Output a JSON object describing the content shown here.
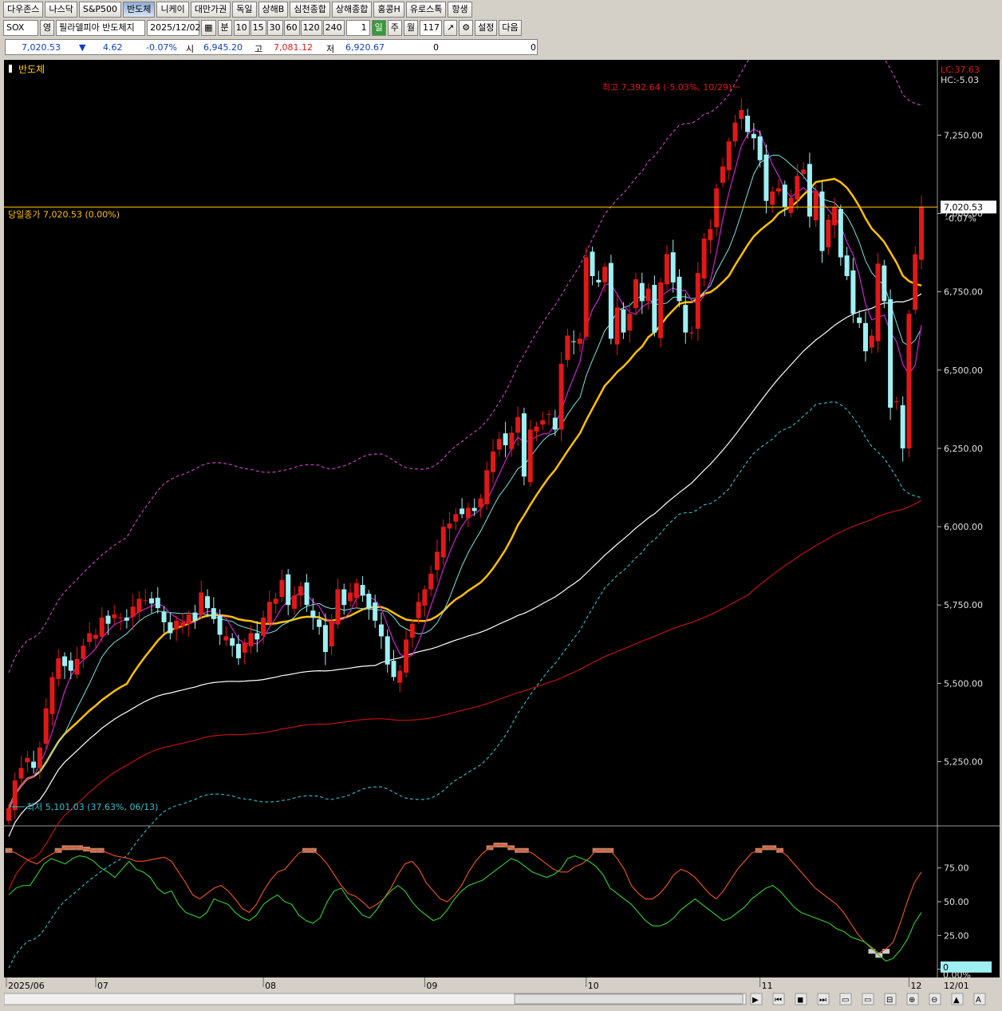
{
  "tabs": [
    "다우존스",
    "나스닥",
    "S&P500",
    "반도체",
    "니케이",
    "대만가권",
    "독일",
    "상해B",
    "심천종합",
    "상해종합",
    "홍콩H",
    "유로스톡",
    "항생"
  ],
  "active_tab": "반도체",
  "toolbar": {
    "symbol": "SOX",
    "mode": "영",
    "name": "필라델피아 반도체지",
    "date": "2025/12/02",
    "minute_label": "분",
    "intervals": [
      "10",
      "15",
      "30",
      "60",
      "120",
      "240"
    ],
    "period_value": "1",
    "day": "일",
    "week": "주",
    "month": "월",
    "count": "117",
    "settings": "설정",
    "next": "다음"
  },
  "quote": {
    "price": "7,020.53",
    "arrow": "▼",
    "change": "4.62",
    "change_pct": "-0.07%",
    "open_label": "시",
    "open": "6,945.20",
    "high_label": "고",
    "high": "7,081.12",
    "low_label": "저",
    "low": "6,920.67",
    "vol1": "0",
    "vol2": "0"
  },
  "colors": {
    "up": "#e01818",
    "down": "#9ef0f4",
    "ma5": "#d020d0",
    "ma10": "#7fe0e0",
    "ma20": "#ffc000",
    "ma60": "#ffffff",
    "ma120": "#c01010",
    "env": "#c040c0",
    "env_low": "#30b0c0",
    "slow": "#30c030",
    "fast": "#e05020"
  },
  "chart_data": {
    "type": "candlestick",
    "title": "반도체",
    "top_right_labels": [
      "LC:37.63",
      "HC:-5.03"
    ],
    "current_line_label": "당일종가 7,020.53 (0.00%)",
    "price_axis_label": "7,020.53",
    "price_axis_pct": "-0.07%",
    "high_annotation": "최고 7,392.64 (-5.03%, 10/29)",
    "low_annotation": "최저 5,101.03 (37.63%, 06/13)",
    "y_ticks": [
      "7,250.00",
      "7,000.00",
      "6,750.00",
      "6,500.00",
      "6,250.00",
      "6,000.00",
      "5,750.00",
      "5,500.00",
      "5,250.00"
    ],
    "y_tick_values": [
      7250,
      7000,
      6750,
      6500,
      6250,
      6000,
      5750,
      5500,
      5250
    ],
    "ylim": [
      5050,
      7470
    ],
    "x_labels": [
      "2025/06",
      "07",
      "08",
      "09",
      "10",
      "11",
      "12",
      "12/01"
    ],
    "x_label_index": [
      0,
      14,
      41,
      67,
      93,
      121,
      145,
      null
    ],
    "current_price": 7020.53,
    "closes": [
      5101,
      5190,
      5230,
      5262,
      5230,
      5295,
      5420,
      5520,
      5580,
      5555,
      5540,
      5578,
      5620,
      5660,
      5655,
      5710,
      5690,
      5720,
      5710,
      5700,
      5745,
      5770,
      5765,
      5755,
      5740,
      5695,
      5660,
      5700,
      5695,
      5720,
      5700,
      5790,
      5740,
      5705,
      5655,
      5650,
      5620,
      5580,
      5630,
      5660,
      5640,
      5710,
      5760,
      5770,
      5830,
      5750,
      5780,
      5810,
      5750,
      5710,
      5680,
      5600,
      5700,
      5800,
      5750,
      5790,
      5820,
      5780,
      5740,
      5700,
      5650,
      5560,
      5520,
      5540,
      5640,
      5690,
      5760,
      5800,
      5850,
      5920,
      6000,
      6010,
      6040,
      6040,
      6060,
      6050,
      6090,
      6180,
      6240,
      6280,
      6260,
      6300,
      6350,
      6160,
      6310,
      6320,
      6340,
      6360,
      6310,
      6520,
      6610,
      6590,
      6600,
      6860,
      6800,
      6780,
      6830,
      6600,
      6700,
      6620,
      6680,
      6790,
      6720,
      6760,
      6620,
      6780,
      6870,
      6780,
      6720,
      6620,
      6620,
      6810,
      6920,
      6950,
      7080,
      7150,
      7230,
      7290,
      7330,
      7260,
      7240,
      7170,
      7040,
      7070,
      7080,
      7020,
      7050,
      7120,
      7140,
      6990,
      7070,
      6880,
      6980,
      7020,
      6860,
      6800,
      6680,
      6650,
      6560,
      6610,
      6840,
      6720,
      6380,
      6400,
      6250,
      6680,
      6870,
      7020
    ],
    "ma_legend": [
      "5",
      "10",
      "20",
      "60",
      "120"
    ],
    "oscillator": {
      "y_ticks": [
        "75.00",
        "50.00",
        "25.00",
        "0.00%"
      ],
      "y_tick_values": [
        75,
        50,
        25,
        0
      ],
      "ylim": [
        -5,
        105
      ],
      "current_label": "0",
      "current_pct": "0.00%",
      "fast": [
        88,
        86,
        83,
        80,
        78,
        82,
        85,
        88,
        90,
        90,
        90,
        89,
        88,
        88,
        86,
        84,
        83,
        82,
        80,
        80,
        81,
        82,
        83,
        80,
        72,
        64,
        55,
        52,
        56,
        60,
        62,
        58,
        52,
        45,
        42,
        48,
        58,
        66,
        72,
        74,
        80,
        86,
        88,
        88,
        84,
        78,
        70,
        62,
        56,
        54,
        50,
        45,
        48,
        52,
        60,
        70,
        78,
        80,
        74,
        64,
        58,
        52,
        50,
        55,
        62,
        72,
        80,
        86,
        90,
        92,
        92,
        90,
        88,
        88,
        86,
        82,
        78,
        74,
        72,
        72,
        76,
        78,
        82,
        88,
        88,
        88,
        82,
        74,
        62,
        56,
        52,
        52,
        56,
        62,
        70,
        74,
        72,
        68,
        62,
        56,
        52,
        58,
        66,
        74,
        80,
        86,
        88,
        90,
        90,
        88,
        84,
        78,
        72,
        66,
        60,
        56,
        52,
        48,
        42,
        34,
        26,
        20,
        15,
        12,
        15,
        20,
        34,
        50,
        64,
        72
      ],
      "slow": [
        55,
        60,
        62,
        62,
        70,
        78,
        82,
        80,
        78,
        82,
        84,
        83,
        80,
        75,
        72,
        68,
        74,
        80,
        74,
        72,
        68,
        60,
        56,
        58,
        48,
        42,
        40,
        38,
        42,
        52,
        50,
        48,
        42,
        38,
        36,
        40,
        48,
        52,
        55,
        50,
        48,
        40,
        36,
        34,
        38,
        50,
        58,
        60,
        52,
        46,
        40,
        38,
        44,
        52,
        58,
        62,
        58,
        50,
        44,
        40,
        36,
        38,
        44,
        52,
        58,
        62,
        64,
        66,
        70,
        74,
        78,
        82,
        80,
        76,
        72,
        70,
        68,
        70,
        74,
        82,
        84,
        82,
        80,
        76,
        70,
        60,
        56,
        52,
        48,
        42,
        36,
        32,
        32,
        34,
        38,
        44,
        48,
        52,
        48,
        44,
        40,
        36,
        38,
        42,
        46,
        52,
        56,
        60,
        62,
        58,
        52,
        46,
        42,
        40,
        38,
        36,
        34,
        30,
        28,
        24,
        22,
        20,
        16,
        10,
        6,
        8,
        14,
        22,
        34,
        42
      ]
    }
  }
}
